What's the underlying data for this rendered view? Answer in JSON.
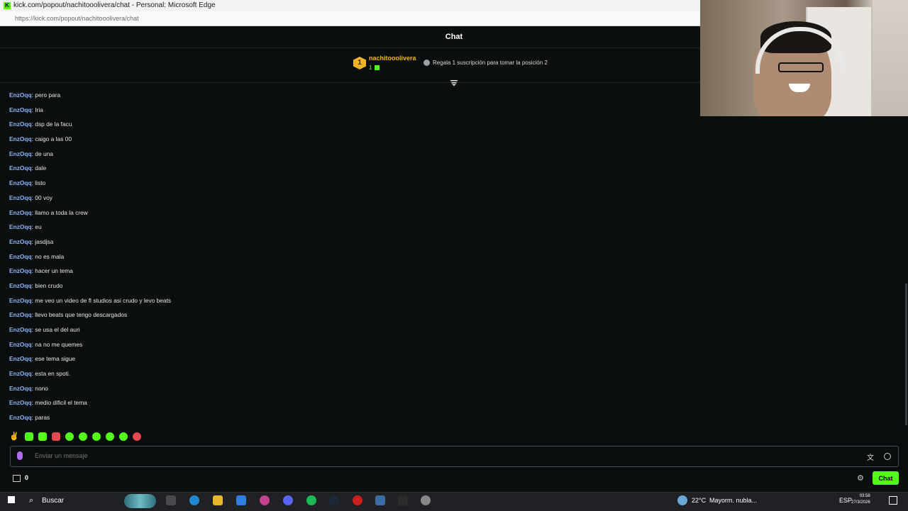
{
  "browser": {
    "window_title": "kick.com/popout/nachitooolivera/chat - Personal: Microsoft Edge",
    "url": "https://kick.com/popout/nachitooolivera/chat"
  },
  "chat": {
    "header_title": "Chat",
    "pinned": {
      "rank": "1",
      "gifter_name": "nachitooolivera",
      "gift_count": "1",
      "cta_text": "Regala 1 suscripción para tomar la posición 2"
    },
    "messages": [
      {
        "user": "EnzOqq",
        "text": "pero para"
      },
      {
        "user": "EnzOqq",
        "text": "Iria"
      },
      {
        "user": "EnzOqq",
        "text": "dsp de la facu"
      },
      {
        "user": "EnzOqq",
        "text": "caigo a las 00"
      },
      {
        "user": "EnzOqq",
        "text": "de una"
      },
      {
        "user": "EnzOqq",
        "text": "dale"
      },
      {
        "user": "EnzOqq",
        "text": "listo"
      },
      {
        "user": "EnzOqq",
        "text": "00 voy"
      },
      {
        "user": "EnzOqq",
        "text": "llamo a toda la crew"
      },
      {
        "user": "EnzOqq",
        "text": "eu"
      },
      {
        "user": "EnzOqq",
        "text": "jasdjsa"
      },
      {
        "user": "EnzOqq",
        "text": "no es mala"
      },
      {
        "user": "EnzOqq",
        "text": "hacer un tema"
      },
      {
        "user": "EnzOqq",
        "text": "bien crudo"
      },
      {
        "user": "EnzOqq",
        "text": "me veo un video de fl studios asi crudo y levo beats"
      },
      {
        "user": "EnzOqq",
        "text": "llevo beats que tengo descargados"
      },
      {
        "user": "EnzOqq",
        "text": "se usa el del auri"
      },
      {
        "user": "EnzOqq",
        "text": "na no me quemes"
      },
      {
        "user": "EnzOqq",
        "text": "ese tema sigue"
      },
      {
        "user": "EnzOqq",
        "text": "esta en spoti."
      },
      {
        "user": "EnzOqq",
        "text": "nono"
      },
      {
        "user": "EnzOqq",
        "text": "medio dificil el tema"
      },
      {
        "user": "EnzOqq",
        "text": "paras"
      }
    ],
    "input_placeholder": "Enviar un mensaje",
    "points_count": "0",
    "send_button_label": "Chat"
  },
  "taskbar": {
    "search_label": "Buscar",
    "weather": "22°C",
    "weather_desc": "Mayorm. nubla...",
    "language": "ESP",
    "time": "03:58",
    "date": "27/3/2026"
  },
  "colors": {
    "accent": "#53fc18",
    "username": "#8ab4f8",
    "gold": "#f0b429",
    "background": "#0b0e0f"
  }
}
